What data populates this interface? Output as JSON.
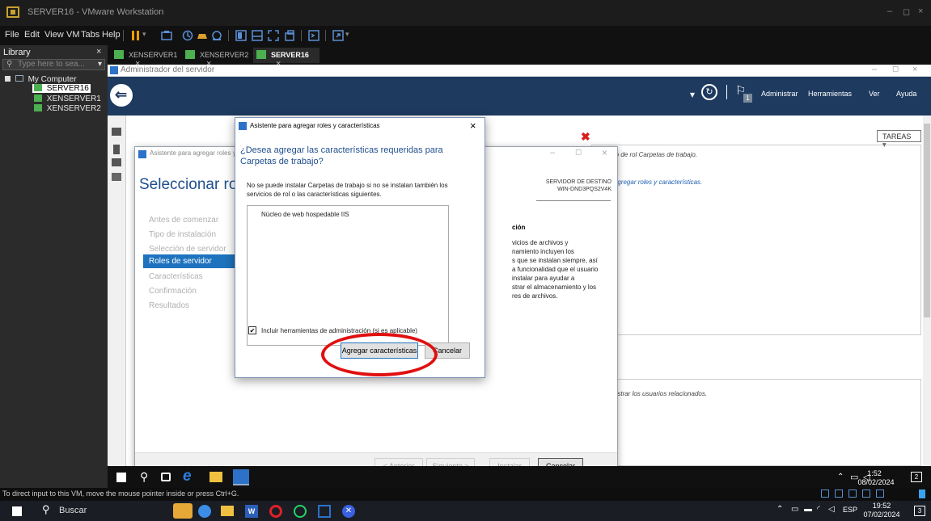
{
  "vmware": {
    "title": "SERVER16 - VMware Workstation",
    "menu": [
      "File",
      "Edit",
      "View",
      "VM",
      "Tabs",
      "Help"
    ],
    "window_controls": [
      "–",
      "◻",
      "×"
    ]
  },
  "library": {
    "header": "Library",
    "close": "×",
    "search_placeholder": "Type here to sea...",
    "root": "My Computer",
    "vms": [
      "SERVER16",
      "XENSERVER1",
      "XENSERVER2"
    ]
  },
  "vm_tabs": [
    {
      "label": "XENSERVER1",
      "close": "×"
    },
    {
      "label": "XENSERVER2",
      "close": "×"
    },
    {
      "label": "SERVER16",
      "close": "×"
    }
  ],
  "server_manager": {
    "title": "Administrador del servidor",
    "menu": [
      "Administrar",
      "Herramientas",
      "Ver",
      "Ayuda"
    ],
    "flag_badge": "1",
    "tareas": "TAREAS",
    "bg_text1": "l servicio de rol Carpetas de trabajo.",
    "bg_text2": "e para agregar roles y características.",
    "bg_text3": "para mostrar los usuarios relacionados."
  },
  "wizard": {
    "title": "Asistente para agregar roles y características",
    "heading": "Seleccionar roles",
    "heading_tail": "ervid",
    "dest_label": "SERVIDOR DE DESTINO",
    "dest_server": "WIN-DND3PQS2V4K",
    "nav": [
      "Antes de comenzar",
      "Tipo de instalación",
      "Selección de servidor",
      "Roles de servidor",
      "Características",
      "Confirmación",
      "Resultados"
    ],
    "desc_title": "ción",
    "desc_lines": [
      "vicios de archivos y",
      "namiento incluyen los",
      "s que se instalan siempre, así",
      "a funcionalidad que el usuario",
      "instalar para ayudar a",
      "strar el almacenamiento y los",
      "res de archivos."
    ],
    "buttons": {
      "prev": "< Anterior",
      "next": "Siguiente >",
      "install": "Instalar",
      "cancel": "Cancelar"
    }
  },
  "dialog": {
    "title": "Asistente para agregar roles y características",
    "close": "×",
    "question": "¿Desea agregar las características requeridas para Carpetas de trabajo?",
    "body": "No se puede instalar Carpetas de trabajo si no se instalan también los servicios de rol o las características siguientes.",
    "features": [
      "Núcleo de web hospedable IIS"
    ],
    "checkbox_label": "Incluir herramientas de administración (si es aplicable)",
    "checkbox_checked": true,
    "add_button": "Agregar características",
    "cancel_button": "Cancelar"
  },
  "guest_clock": {
    "time": "1:52",
    "date": "08/02/2024",
    "notif": "2"
  },
  "vm_status": "To direct input to this VM, move the mouse pointer inside or press Ctrl+G.",
  "host_taskbar": {
    "search": "Buscar",
    "lang": "ESP",
    "time": "19:52",
    "date": "07/02/2024",
    "notif": "3"
  }
}
